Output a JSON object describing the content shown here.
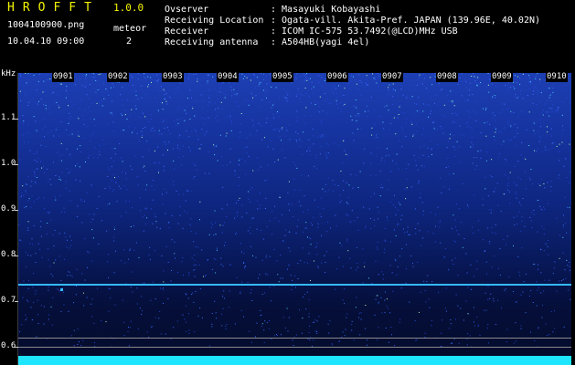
{
  "header": {
    "app_name": "HROFFT",
    "version": "1.0.0",
    "filename": "1004100900.png",
    "datetime": "10.04.10 09:00",
    "meteor_label": "meteor",
    "meteor_count": "2",
    "info": [
      {
        "label": "Ovserver",
        "value": ": Masayuki Kobayashi"
      },
      {
        "label": "Receiving Location",
        "value": ": Ogata-vill. Akita-Pref. JAPAN (139.96E, 40.02N)"
      },
      {
        "label": "Receiver",
        "value": ": ICOM IC-575 53.7492(@LCD)MHz USB"
      },
      {
        "label": "Receiving antenna",
        "value": ": A504HB(yagi 4el)"
      }
    ]
  },
  "spectrogram": {
    "y_unit": "kHz",
    "time_labels": [
      "0901",
      "0902",
      "0903",
      "0904",
      "0905",
      "0906",
      "0907",
      "0908",
      "0909",
      "0910"
    ],
    "freq_labels": [
      "1.1",
      "1.0",
      "0.9",
      "0.8",
      "0.7",
      "0.6"
    ],
    "colors": {
      "background_hi": "#1d3fb4",
      "background_lo": "#040b2a",
      "carrier": "#35b8ff",
      "noise_floor": "#1ee6ff"
    }
  }
}
